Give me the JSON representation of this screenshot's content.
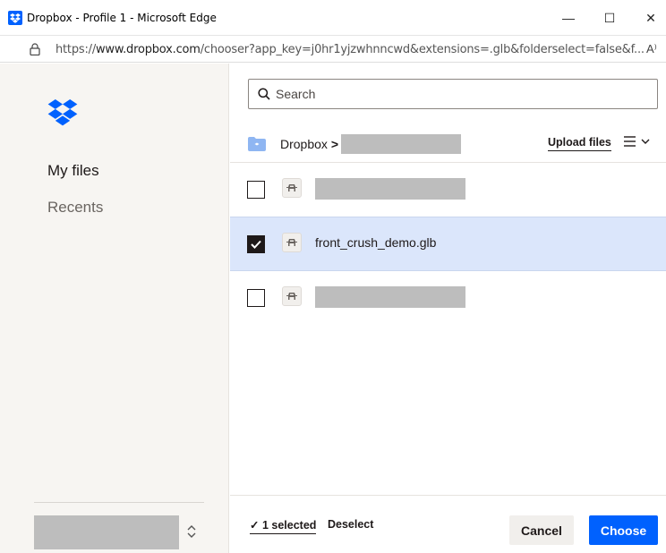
{
  "window": {
    "title": "Dropbox - Profile 1 - Microsoft Edge",
    "minimize_glyph": "—",
    "maximize_glyph": "☐",
    "close_glyph": "✕"
  },
  "address_bar": {
    "url_scheme": "https://",
    "url_host": "www.dropbox.com",
    "url_rest": "/chooser?app_key=j0hr1yjzwhnncwd&extensions=.glb&folderselect=false&f...",
    "read_aloud_glyph": "A⁾"
  },
  "sidebar": {
    "items": [
      {
        "label": "My files",
        "active": true
      },
      {
        "label": "Recents",
        "active": false
      }
    ]
  },
  "search": {
    "placeholder": "Search"
  },
  "breadcrumb": {
    "root": "Dropbox",
    "separator": ">"
  },
  "toolbar": {
    "upload_label": "Upload files"
  },
  "files": [
    {
      "name": "",
      "redacted": true,
      "checked": false
    },
    {
      "name": "front_crush_demo.glb",
      "redacted": false,
      "checked": true
    },
    {
      "name": "",
      "redacted": true,
      "checked": false
    }
  ],
  "footer": {
    "selected_label": "✓ 1 selected",
    "deselect_label": "Deselect",
    "cancel_label": "Cancel",
    "choose_label": "Choose"
  },
  "colors": {
    "accent": "#0061fe",
    "selected_row": "#dbe6fb",
    "sidebar_bg": "#f7f5f2",
    "redaction": "#bdbdbd"
  },
  "icons": {
    "app": "dropbox-icon",
    "lock": "lock-icon",
    "search": "search-icon",
    "folder": "folder-icon",
    "file": "3d-model-file-icon",
    "view": "list-view-icon",
    "chevrons": "chevron-updown-icon"
  }
}
